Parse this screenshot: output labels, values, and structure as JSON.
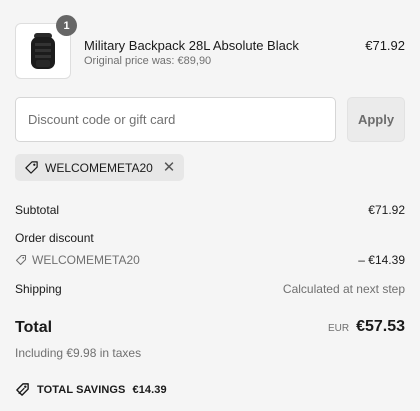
{
  "product": {
    "quantity": "1",
    "name": "Military Backpack 28L Absolute Black",
    "original_price_text": "Original price was: €89,90",
    "price": "€71.92"
  },
  "discount": {
    "placeholder": "Discount code or gift card",
    "value": "",
    "apply_label": "Apply"
  },
  "applied_code": {
    "code": "WELCOMEMETA20",
    "remove_icon": "close-icon"
  },
  "summary": {
    "subtotal_label": "Subtotal",
    "subtotal_value": "€71.92",
    "order_discount_label": "Order discount",
    "order_discount_code": "WELCOMEMETA20",
    "order_discount_value": "– €14.39",
    "shipping_label": "Shipping",
    "shipping_value": "Calculated at next step",
    "total_label": "Total",
    "total_currency": "EUR",
    "total_value": "€57.53",
    "taxes_text": "Including €9.98 in taxes",
    "savings_label": "TOTAL SAVINGS",
    "savings_value": "€14.39"
  },
  "colors": {
    "background": "#f5f5f5",
    "text": "#1a1a1a",
    "muted": "#707070",
    "chip": "#e7e7e7"
  }
}
